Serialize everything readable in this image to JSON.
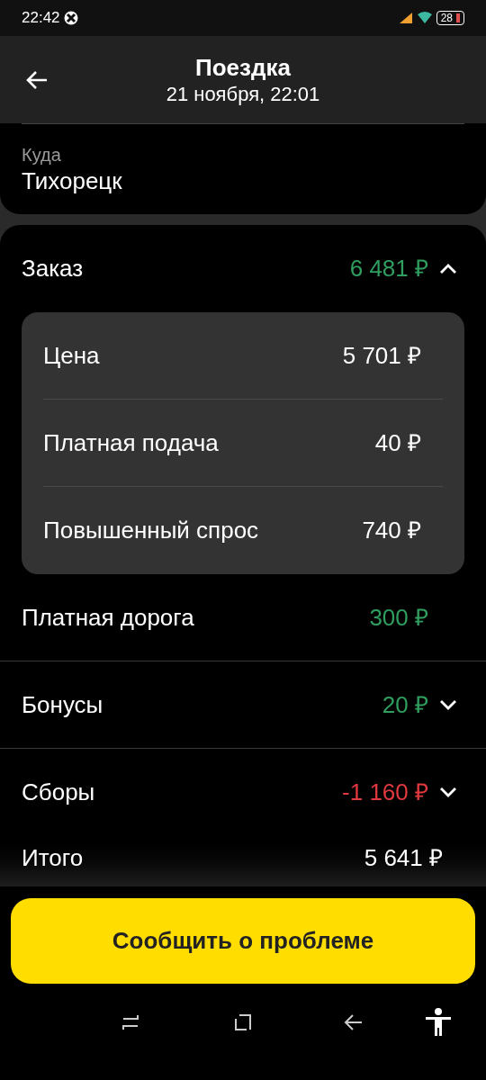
{
  "status_bar": {
    "time": "22:42",
    "battery": "28"
  },
  "header": {
    "title": "Поездка",
    "subtitle": "21 ноября, 22:01"
  },
  "destination": {
    "label": "Куда",
    "value": "Тихорецк"
  },
  "order": {
    "label": "Заказ",
    "amount": "6 481 ₽",
    "color": "#2f9e5f",
    "expanded": true,
    "items": [
      {
        "label": "Цена",
        "amount": "5 701 ₽"
      },
      {
        "label": "Платная подача",
        "amount": "40 ₽"
      },
      {
        "label": "Повышенный спрос",
        "amount": "740 ₽"
      }
    ]
  },
  "rows": [
    {
      "label": "Платная дорога",
      "amount": "300 ₽",
      "color": "#2f9e5f"
    },
    {
      "label": "Бонусы",
      "amount": "20 ₽",
      "color": "#2f9e5f",
      "expanded": false
    },
    {
      "label": "Сборы",
      "amount": "-1 160 ₽",
      "color": "#e0393e",
      "expanded": false
    }
  ],
  "total": {
    "label": "Итого",
    "amount": "5 641 ₽"
  },
  "report_button": "Сообщить о проблеме"
}
